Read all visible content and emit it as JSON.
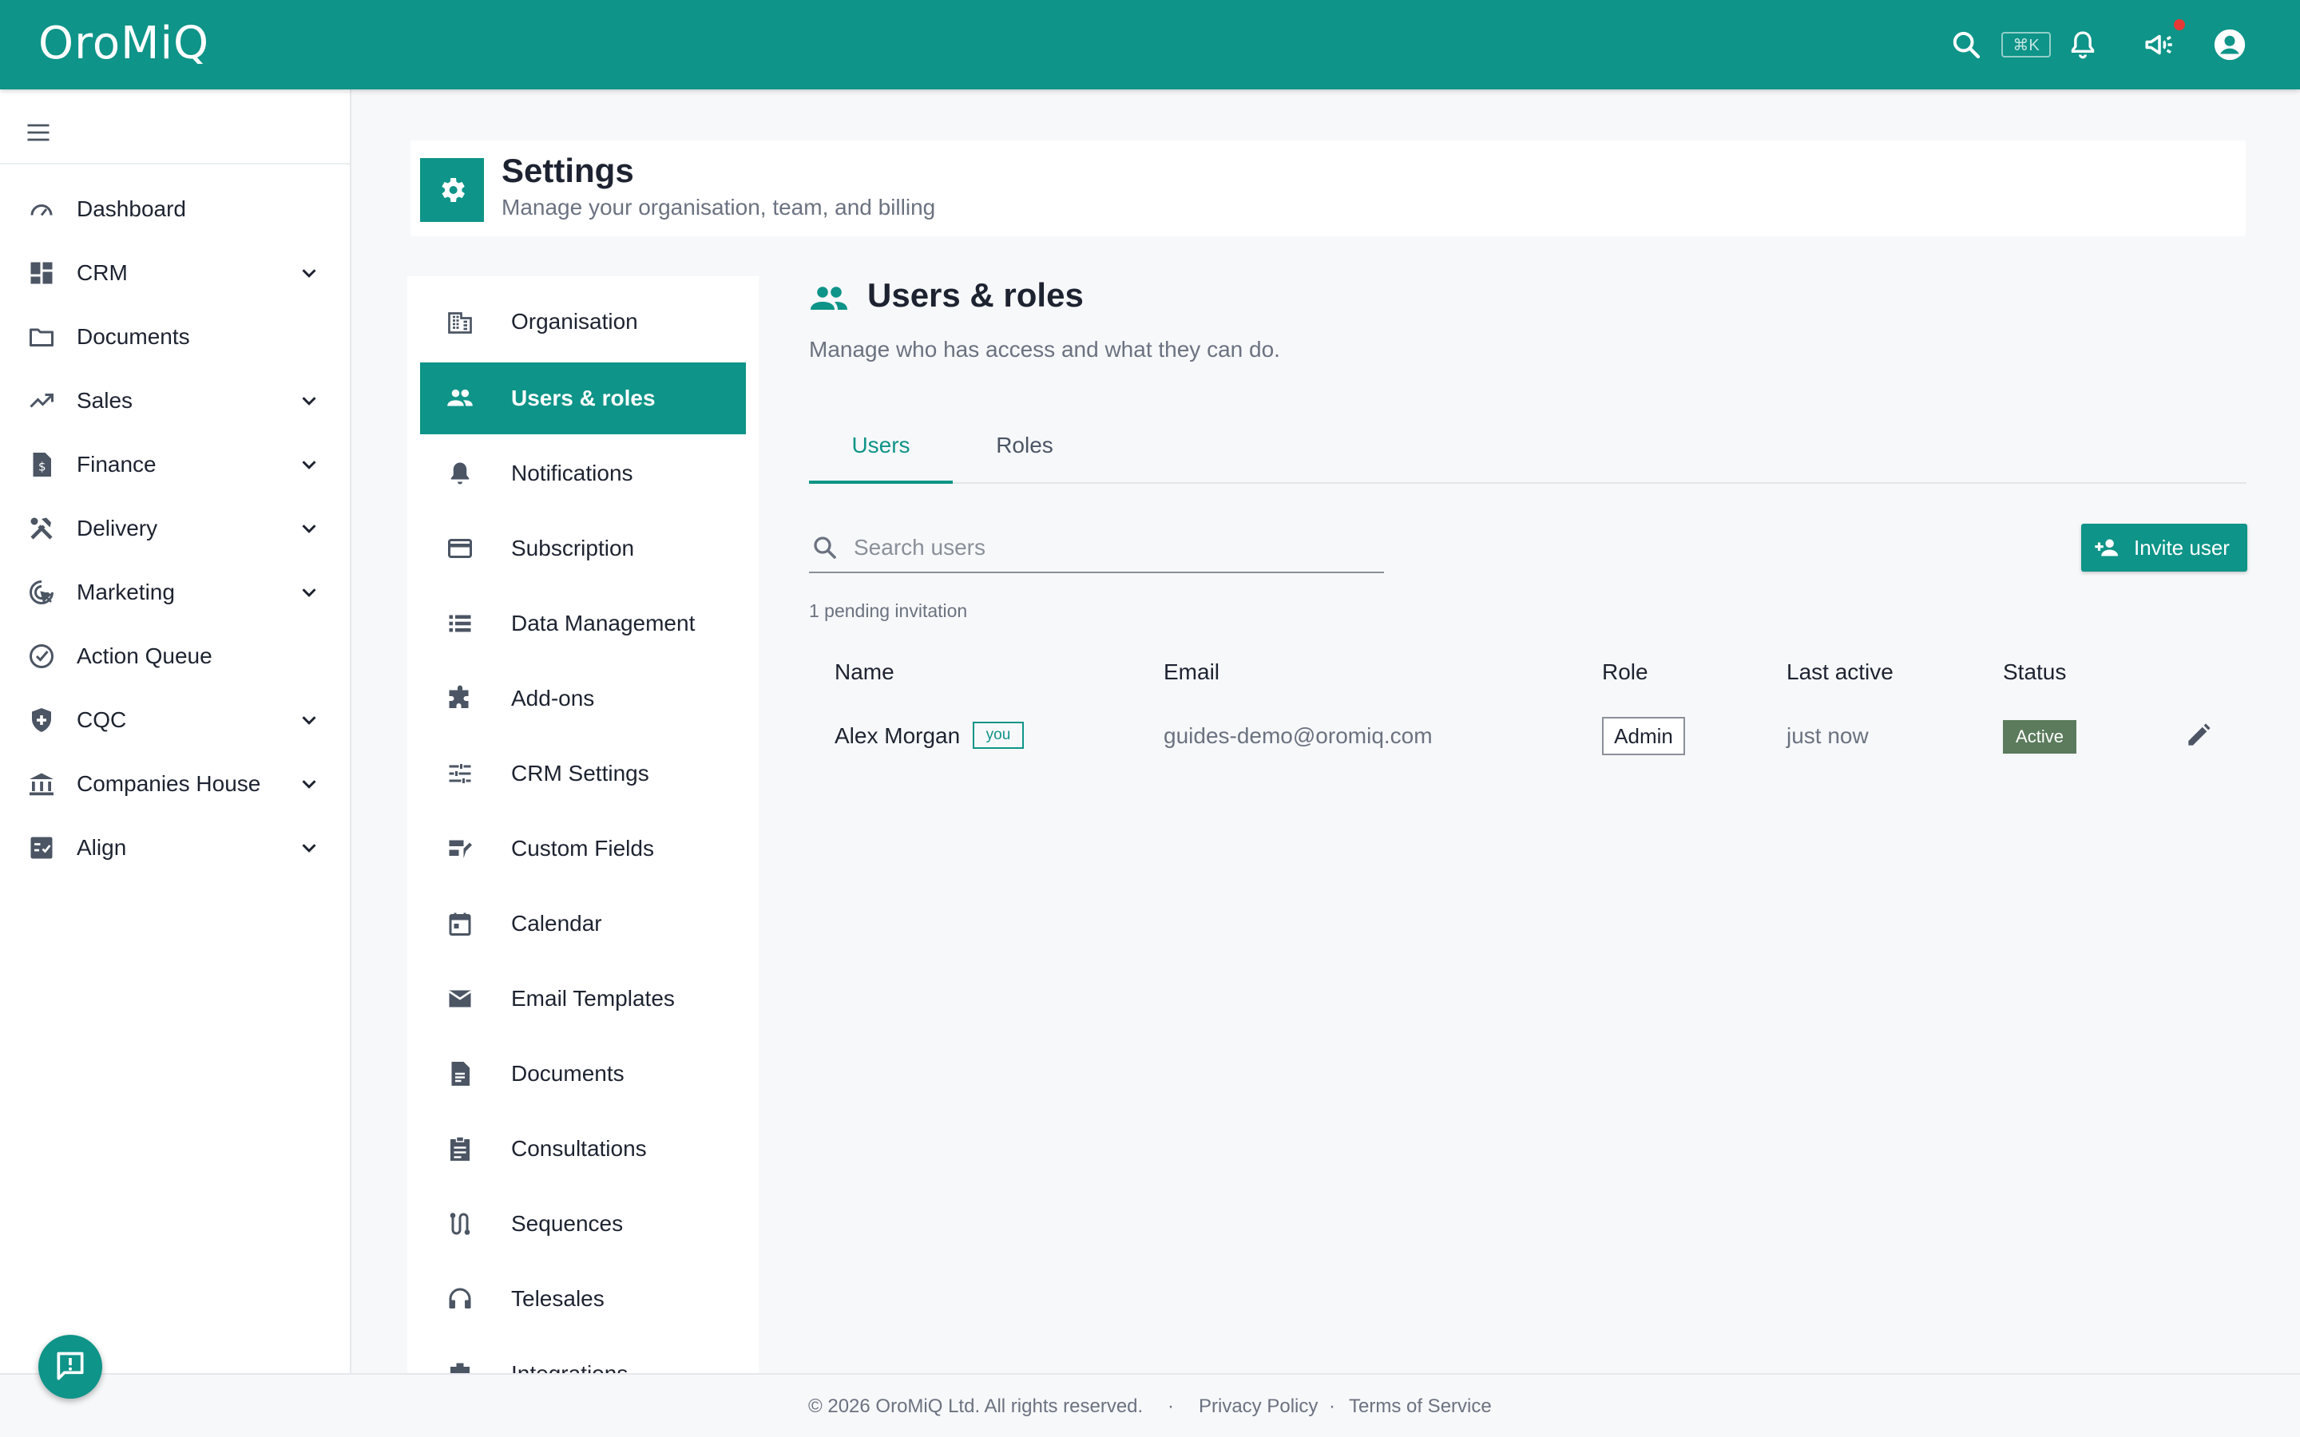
{
  "app": {
    "logo": "OroMiQ",
    "accent": "#0e9488"
  },
  "topbar": {
    "shortcut": "⌘K",
    "icons": [
      "search-icon",
      "notifications-icon",
      "announcements-icon",
      "account-icon"
    ]
  },
  "sidebar": {
    "items": [
      {
        "label": "Dashboard",
        "icon": "speedometer-icon",
        "expandable": false
      },
      {
        "label": "CRM",
        "icon": "dashboard-grid-icon",
        "expandable": true
      },
      {
        "label": "Documents",
        "icon": "folder-icon",
        "expandable": false
      },
      {
        "label": "Sales",
        "icon": "trending-up-icon",
        "expandable": true
      },
      {
        "label": "Finance",
        "icon": "invoice-icon",
        "expandable": true
      },
      {
        "label": "Delivery",
        "icon": "tools-icon",
        "expandable": true
      },
      {
        "label": "Marketing",
        "icon": "target-icon",
        "expandable": true
      },
      {
        "label": "Action Queue",
        "icon": "check-circle-icon",
        "expandable": false
      },
      {
        "label": "CQC",
        "icon": "shield-icon",
        "expandable": true
      },
      {
        "label": "Companies House",
        "icon": "bank-icon",
        "expandable": true
      },
      {
        "label": "Align",
        "icon": "checklist-icon",
        "expandable": true
      }
    ]
  },
  "header": {
    "title": "Settings",
    "subtitle": "Manage your organisation, team, and billing"
  },
  "settings_nav": {
    "active": "Users & roles",
    "items": [
      {
        "label": "Organisation",
        "icon": "building-icon"
      },
      {
        "label": "Users & roles",
        "icon": "people-icon"
      },
      {
        "label": "Notifications",
        "icon": "bell-icon"
      },
      {
        "label": "Subscription",
        "icon": "credit-card-icon"
      },
      {
        "label": "Data Management",
        "icon": "list-icon"
      },
      {
        "label": "Add-ons",
        "icon": "puzzle-icon"
      },
      {
        "label": "CRM Settings",
        "icon": "sliders-icon"
      },
      {
        "label": "Custom Fields",
        "icon": "custom-fields-icon"
      },
      {
        "label": "Calendar",
        "icon": "calendar-icon"
      },
      {
        "label": "Email Templates",
        "icon": "mail-icon"
      },
      {
        "label": "Documents",
        "icon": "document-icon"
      },
      {
        "label": "Consultations",
        "icon": "clipboard-icon"
      },
      {
        "label": "Sequences",
        "icon": "route-icon"
      },
      {
        "label": "Telesales",
        "icon": "headset-icon"
      },
      {
        "label": "Integrations",
        "icon": "integrations-icon"
      }
    ]
  },
  "main": {
    "title": "Users & roles",
    "subtitle": "Manage who has access and what they can do.",
    "tabs": [
      {
        "label": "Users",
        "active": true
      },
      {
        "label": "Roles",
        "active": false
      }
    ],
    "search": {
      "placeholder": "Search users",
      "value": ""
    },
    "invite_label": "Invite user",
    "pending": "1 pending invitation",
    "table": {
      "headers": [
        "Name",
        "Email",
        "Role",
        "Last active",
        "Status"
      ],
      "rows": [
        {
          "name": "Alex Morgan",
          "badge": "you",
          "email": "guides-demo@oromiq.com",
          "role": "Admin",
          "last_active": "just now",
          "status": "Active"
        }
      ]
    }
  },
  "footer": {
    "copyright": "© 2026 OroMiQ Ltd. All rights reserved.",
    "sep": "·",
    "privacy": "Privacy Policy",
    "terms": "Terms of Service"
  }
}
